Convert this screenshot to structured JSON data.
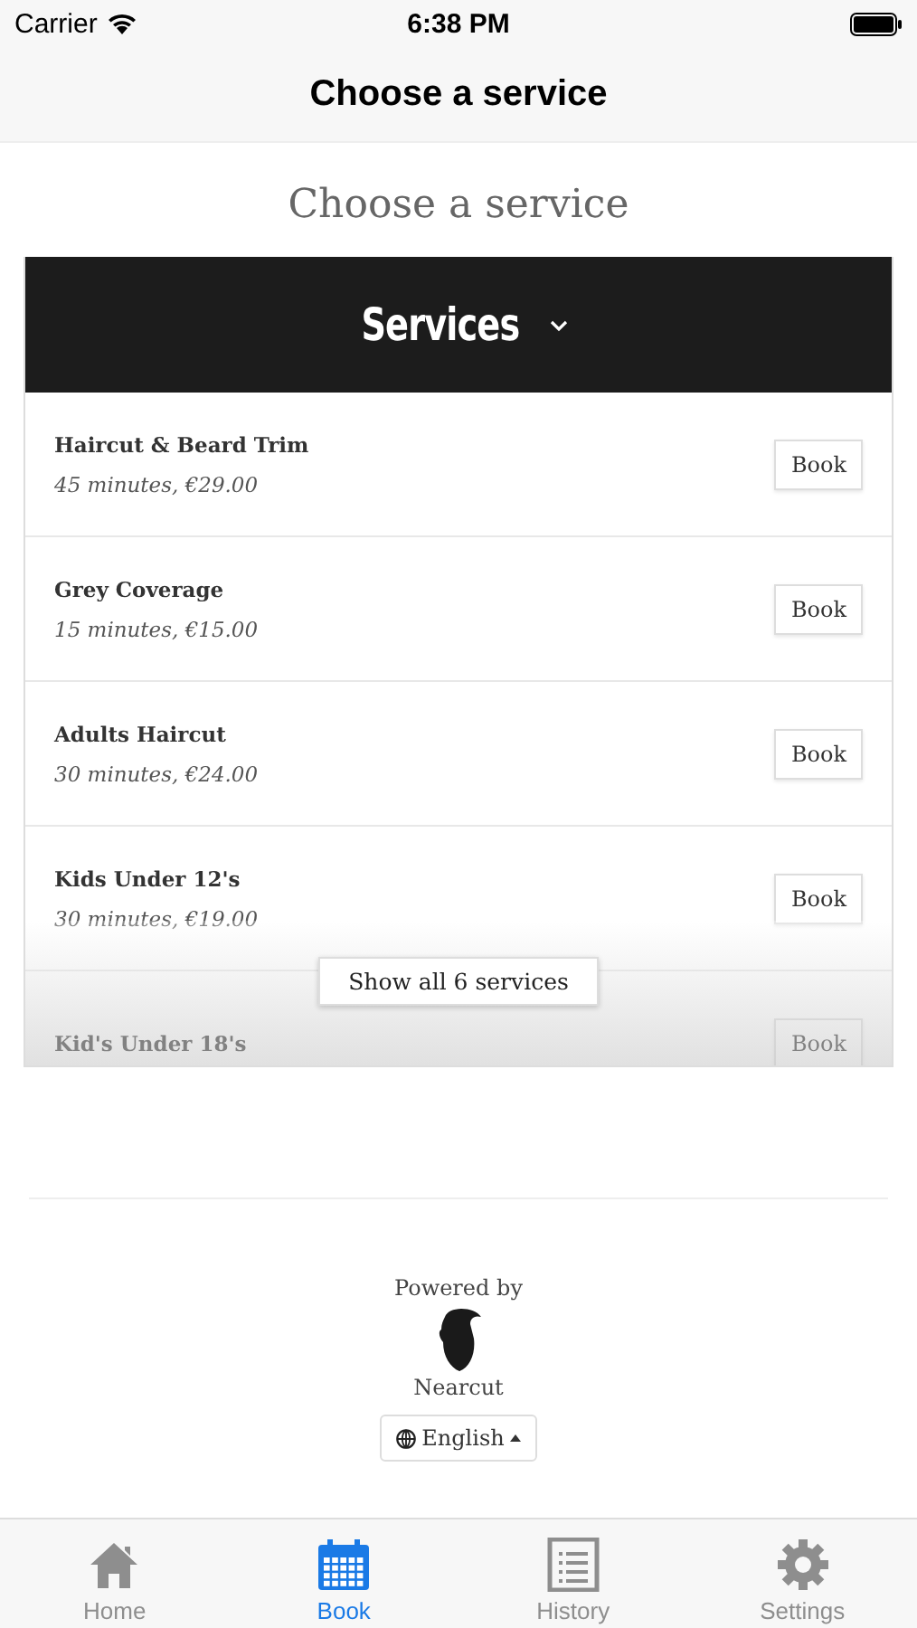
{
  "status_bar": {
    "carrier": "Carrier",
    "time": "6:38 PM"
  },
  "nav_bar": {
    "title": "Choose a service"
  },
  "heading": "Choose a service",
  "services_header": {
    "title": "Services",
    "expanded": true
  },
  "services": [
    {
      "name": "Haircut & Beard Trim",
      "details": "45 minutes, €29.00",
      "action": "Book"
    },
    {
      "name": "Grey Coverage",
      "details": "15 minutes, €15.00",
      "action": "Book"
    },
    {
      "name": "Adults Haircut",
      "details": "30 minutes, €24.00",
      "action": "Book"
    },
    {
      "name": "Kids Under 12's",
      "details": "30 minutes, €19.00",
      "action": "Book"
    },
    {
      "name": "Kid's Under 18's",
      "action": "Book"
    }
  ],
  "show_all": "Show all 6 services",
  "footer": {
    "powered_by": "Powered by",
    "brand": "Nearcut",
    "language": "English"
  },
  "tabs": [
    {
      "label": "Home",
      "kind": "home",
      "selected": false
    },
    {
      "label": "Book",
      "kind": "calendar",
      "selected": true
    },
    {
      "label": "History",
      "kind": "list",
      "selected": false
    },
    {
      "label": "Settings",
      "kind": "gear",
      "selected": false
    }
  ]
}
